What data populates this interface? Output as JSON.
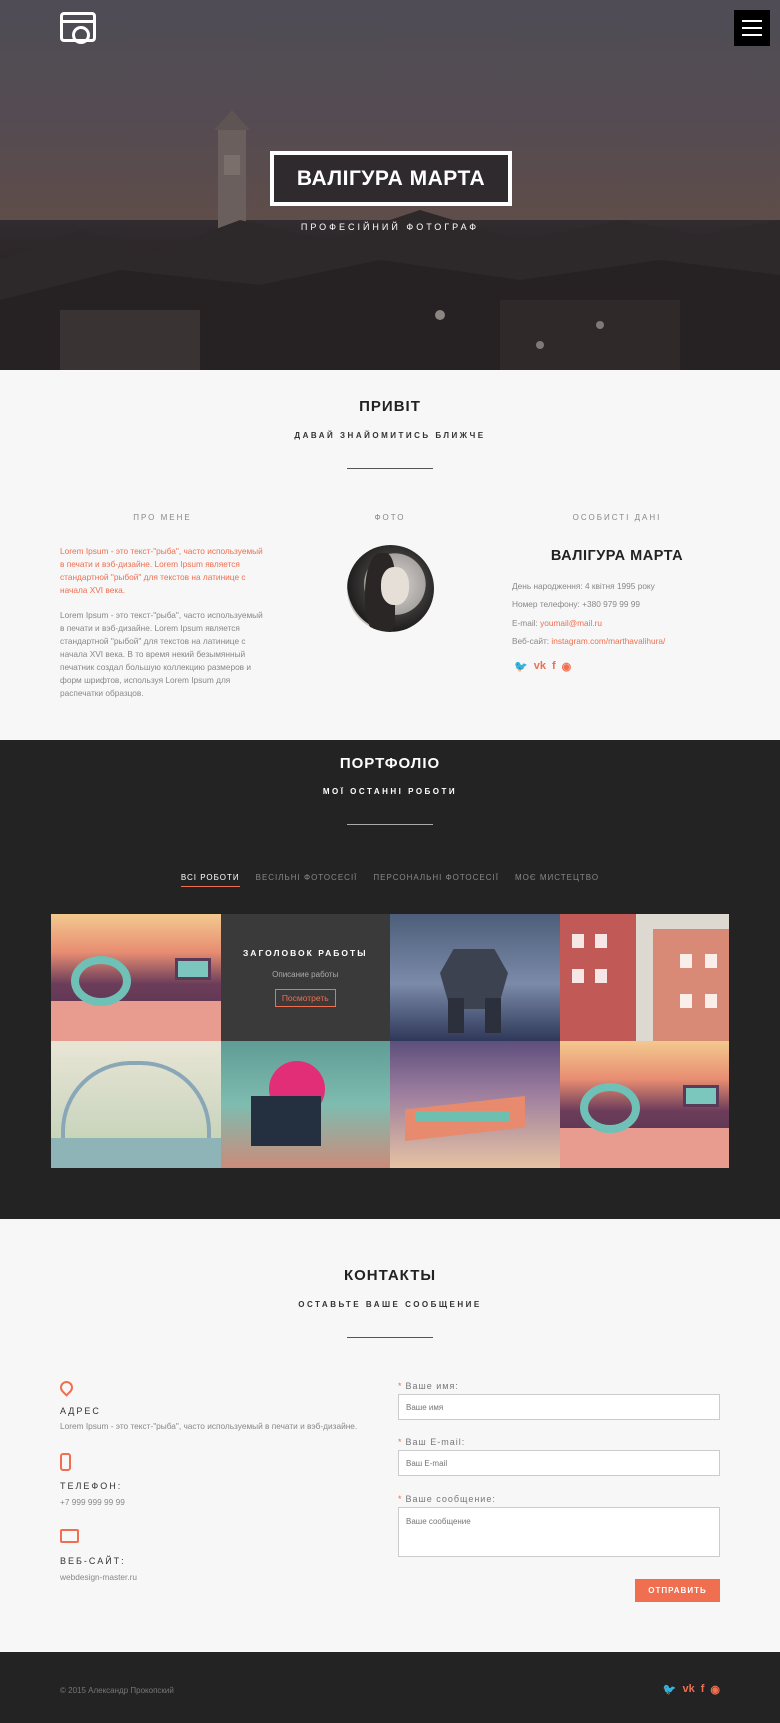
{
  "header": {
    "logo_icon": "camera-icon",
    "menu_icon": "hamburger-menu-icon",
    "title": "ВАЛІГУРА МАРТА",
    "subtitle": "ПРОФЕСІЙНИЙ ФОТОГРАФ"
  },
  "about": {
    "title": "ПРИВІТ",
    "subtitle": "ДАВАЙ ЗНАЙОМИТИСЬ БЛИЖЧЕ",
    "col_about": "ПРО МЕНЕ",
    "col_photo": "ФОТО",
    "col_personal": "ОСОБИСТІ ДАНІ",
    "text_highlight": "Lorem Ipsum - это текст-\"рыба\", часто используемый в печати и вэб-дизайне. Lorem Ipsum является стандартной \"рыбой\" для текстов на латинице с начала XVI века.",
    "text_body": "Lorem Ipsum - это текст-\"рыба\", часто используемый в печати и вэб-дизайне. Lorem Ipsum является стандартной \"рыбой\" для текстов на латинице с начала XVI века. В то время некий безымянный печатник создал большую коллекцию размеров и форм шрифтов, используя Lorem Ipsum для распечатки образцов.",
    "name": "ВАЛІГУРА МАРТА",
    "birth": "День народження: 4 квітня 1995 року",
    "phone": "Номер телефону: +380 979 99 99",
    "email_label": "E-mail: ",
    "email": "youmail@mail.ru",
    "site_label": "Веб-сайт: ",
    "site": "instagram.com/marthavalihura/",
    "social": [
      "twitter-icon",
      "vk-icon",
      "facebook-icon",
      "github-icon"
    ]
  },
  "portfolio": {
    "title": "ПОРТФОЛІО",
    "subtitle": "МОЇ ОСТАННІ РОБОТИ",
    "filters": [
      "ВСІ РОБОТИ",
      "ВЕСІЛЬНІ ФОТОСЕСІЇ",
      "ПЕРСОНАЛЬНІ ФОТОСЕСІЇ",
      "МОЄ МИСТЕЦТВО"
    ],
    "active_filter": "ВСІ РОБОТИ",
    "overlay": {
      "title": "ЗАГОЛОВОК РАБОТЫ",
      "desc": "Описание работы",
      "button": "Посмотреть"
    }
  },
  "contacts": {
    "title": "КОНТАКТЫ",
    "subtitle": "ОСТАВЬТЕ ВАШЕ СООБЩЕНИЕ",
    "address_label": "АДРЕС",
    "address": "Lorem Ipsum - это текст-\"рыба\", часто используемый в печати и вэб-дизайне.",
    "phone_label": "ТЕЛЕФОН:",
    "phone": "+7 999 999 99 99",
    "site_label": "ВЕБ-САЙТ:",
    "site": "webdesign-master.ru",
    "form": {
      "name_label": "Ваше имя:",
      "name_placeholder": "Ваше имя",
      "email_label": "Ваш E-mail:",
      "email_placeholder": "Ваш E-mail",
      "message_label": "Ваше сообщение:",
      "message_placeholder": "Ваше сообщение",
      "submit": "ОТПРАВИТЬ"
    }
  },
  "footer": {
    "copyright": "© 2015 Александр Прокопский"
  },
  "colors": {
    "accent": "#ef6f50",
    "dark": "#232323"
  }
}
